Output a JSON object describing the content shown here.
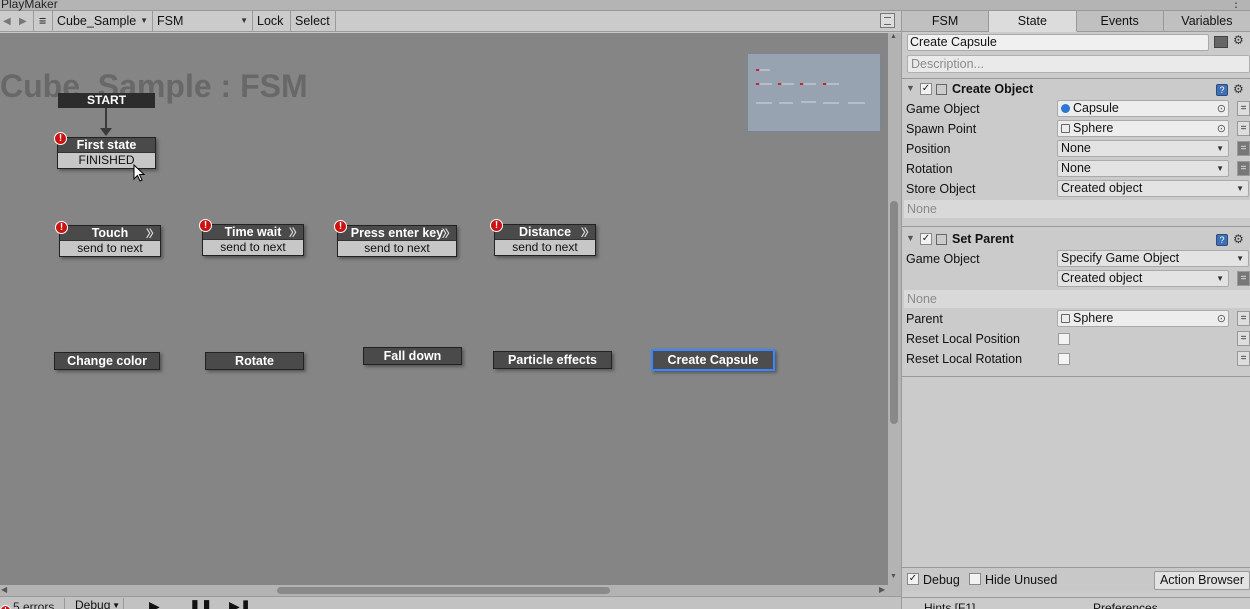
{
  "window": {
    "title": "PlayMaker"
  },
  "toolbar": {
    "gameobject": "Cube_Sample",
    "fsm": "FSM",
    "lock": "Lock",
    "select": "Select"
  },
  "graph": {
    "title": "Cube_Sample : FSM",
    "start_label": "START",
    "states": [
      {
        "name": "First state",
        "transition": "FINISHED",
        "error": true
      },
      {
        "name": "Touch",
        "transition": "send to next",
        "error": true
      },
      {
        "name": "Time wait",
        "transition": "send to next",
        "error": true
      },
      {
        "name": "Press enter key",
        "transition": "send to next",
        "error": true
      },
      {
        "name": "Distance",
        "transition": "send to next",
        "error": true
      },
      {
        "name": "Change color"
      },
      {
        "name": "Rotate"
      },
      {
        "name": "Fall down"
      },
      {
        "name": "Particle effects"
      },
      {
        "name": "Create Capsule",
        "selected": true
      }
    ]
  },
  "statusbar": {
    "errors": "5 errors",
    "debug": "Debug"
  },
  "inspector": {
    "tabs": [
      "FSM",
      "State",
      "Events",
      "Variables"
    ],
    "active_tab": "State",
    "state_name": "Create Capsule",
    "description_placeholder": "Description...",
    "actions": [
      {
        "title": "Create Object",
        "fields": [
          {
            "label": "Game Object",
            "value": "Capsule"
          },
          {
            "label": "Spawn Point",
            "value": "Sphere"
          },
          {
            "label": "Position",
            "value": "None"
          },
          {
            "label": "Rotation",
            "value": "None"
          },
          {
            "label": "Store Object",
            "value": "Created object"
          }
        ],
        "none_text": "None"
      },
      {
        "title": "Set Parent",
        "fields": [
          {
            "label": "Game Object",
            "value": "Specify Game Object"
          },
          {
            "label": "",
            "value": "Created object"
          },
          {
            "label": "Parent",
            "value": "Sphere"
          },
          {
            "label": "Reset Local Position",
            "value": ""
          },
          {
            "label": "Reset Local Rotation",
            "value": ""
          }
        ],
        "none_text": "None"
      }
    ],
    "footer": {
      "debug": "Debug",
      "hide_unused": "Hide Unused",
      "action_browser": "Action Browser",
      "hints": "Hints [F1]",
      "preferences": "Preferences"
    }
  },
  "colors": {
    "canvas": "#858585",
    "state_body": "#4a4a4a",
    "selected_border": "#3a86ff",
    "error_badge": "#cc1111"
  }
}
